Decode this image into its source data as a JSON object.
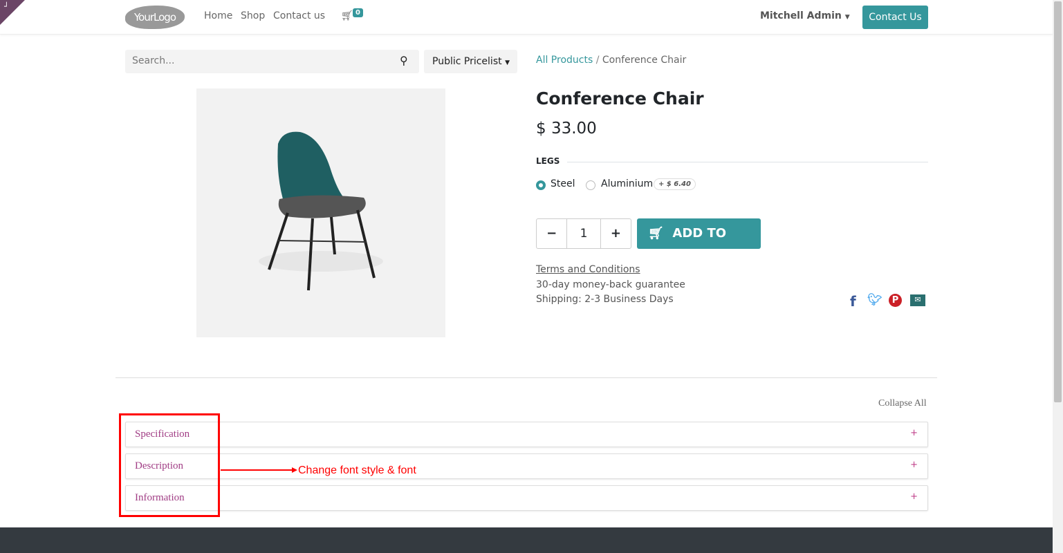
{
  "nav": {
    "logo": "YourLogo",
    "links": [
      "Home",
      "Shop",
      "Contact us"
    ],
    "cart_count": "0",
    "user": "Mitchell Admin",
    "contact_button": "Contact Us"
  },
  "search": {
    "placeholder": "Search...",
    "pricelist": "Public Pricelist"
  },
  "breadcrumb": {
    "parent": "All Products",
    "separator": "/",
    "current": "Conference Chair"
  },
  "product": {
    "name": "Conference Chair",
    "price": "$ 33.00",
    "attribute": "LEGS",
    "options": [
      {
        "label": "Steel",
        "selected": true
      },
      {
        "label": "Aluminium",
        "selected": false,
        "extra": "+ $ 6.40"
      }
    ],
    "quantity": "1",
    "add_to_cart": "ADD TO CART",
    "terms": "Terms and Conditions",
    "guarantee": "30-day money-back guarantee",
    "shipping": "Shipping: 2-3 Business Days"
  },
  "social": [
    "facebook",
    "twitter",
    "pinterest",
    "email"
  ],
  "tabs": {
    "collapse_all": "Collapse All",
    "items": [
      "Specification",
      "Description",
      "Information"
    ],
    "toggle": "+"
  },
  "annotation": "Change font style & font",
  "colors": {
    "primary": "#35979c",
    "accordion_text": "#a03c84",
    "annotation": "#ff0000"
  }
}
